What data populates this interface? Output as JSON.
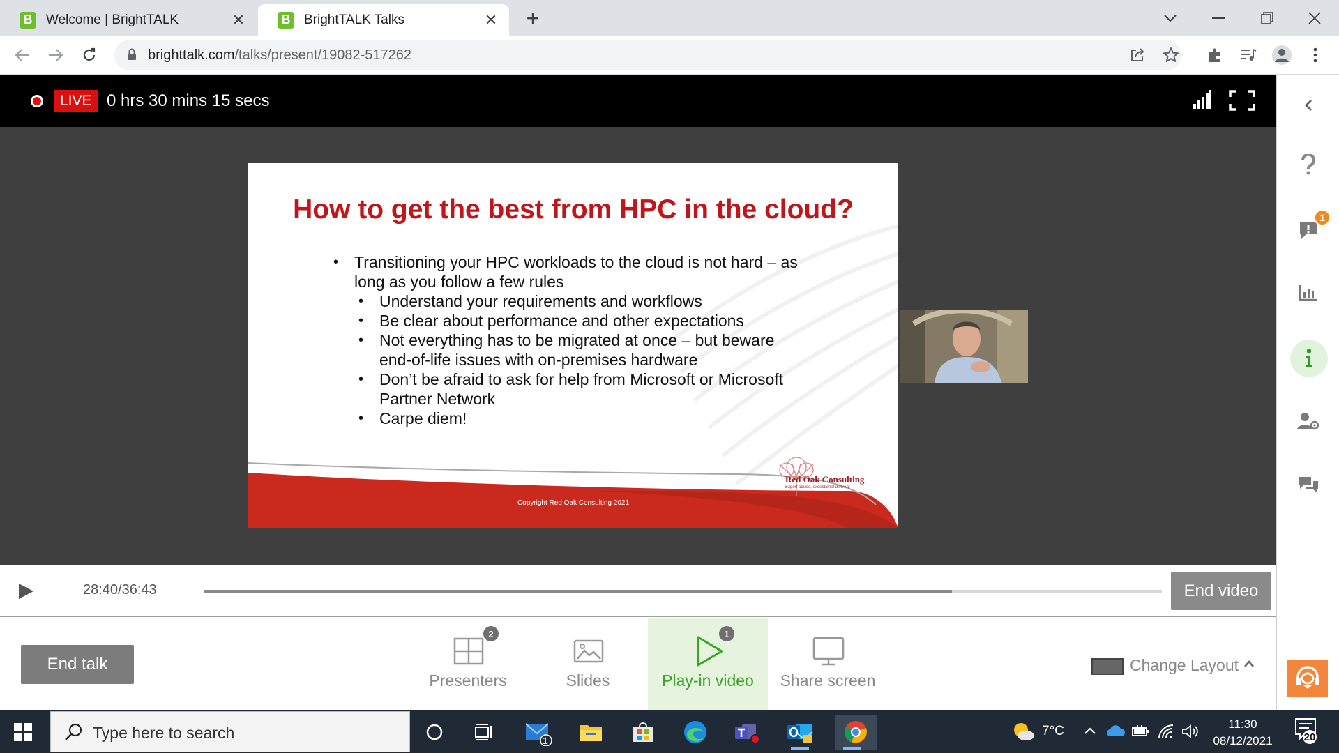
{
  "browser": {
    "tabs": [
      {
        "title": "Welcome | BrightTALK",
        "favicon": "B",
        "active": false
      },
      {
        "title": "BrightTALK Talks",
        "favicon": "B",
        "active": true
      }
    ],
    "url_host": "brighttalk.com",
    "url_path": "/talks/present/19082-517262"
  },
  "live": {
    "badge": "LIVE",
    "elapsed": "0 hrs 30 mins 15 secs"
  },
  "slide": {
    "title": "How to get the best from HPC in the cloud?",
    "bullets": [
      {
        "text": "Transitioning your HPC workloads to the cloud is not hard – as long as you follow a few rules",
        "level": 1
      },
      {
        "text": "Understand your requirements and workflows",
        "level": 2
      },
      {
        "text": "Be clear about performance and other expectations",
        "level": 2
      },
      {
        "text": "Not everything has to be migrated at once – but beware end-of-life issues with on-premises hardware",
        "level": 2
      },
      {
        "text": "Don’t be afraid to ask for help from Microsoft or Microsoft Partner Network",
        "level": 2
      },
      {
        "text": "Carpe diem!",
        "level": 2
      }
    ],
    "copyright": "Copyright Red Oak Consulting 2021",
    "logo_name": "Red Oak Consulting",
    "logo_tagline": "Expert advice, exceptional delivery",
    "title_color": "#c0151b"
  },
  "player": {
    "current": "28:40",
    "separator": "/",
    "duration": "36:43",
    "progress": 0.781,
    "end_video_label": "End video"
  },
  "controls": {
    "end_talk_label": "End talk",
    "items": [
      {
        "label": "Presenters",
        "badge": "2",
        "icon": "grid-icon",
        "active": false
      },
      {
        "label": "Slides",
        "badge": "",
        "icon": "image-icon",
        "active": false
      },
      {
        "label": "Play-in video",
        "badge": "1",
        "icon": "play-outline-icon",
        "active": true
      },
      {
        "label": "Share screen",
        "badge": "",
        "icon": "monitor-icon",
        "active": false
      }
    ],
    "change_layout_label": "Change Layout"
  },
  "rail": {
    "alerts_badge": "1",
    "items": [
      "collapse-chevron-icon",
      "help-icon",
      "alert-icon",
      "poll-chart-icon",
      "info-icon",
      "user-settings-icon",
      "chat-icon"
    ]
  },
  "taskbar": {
    "search_placeholder": "Type here to search",
    "mail_badge": "1",
    "temperature": "7°C",
    "time": "11:30",
    "date": "08/12/2021",
    "notifications": "20"
  },
  "colors": {
    "live_red": "#d91010",
    "active_green": "#3aa526",
    "active_bg": "#e6f4df",
    "support_orange": "#f3863a"
  }
}
